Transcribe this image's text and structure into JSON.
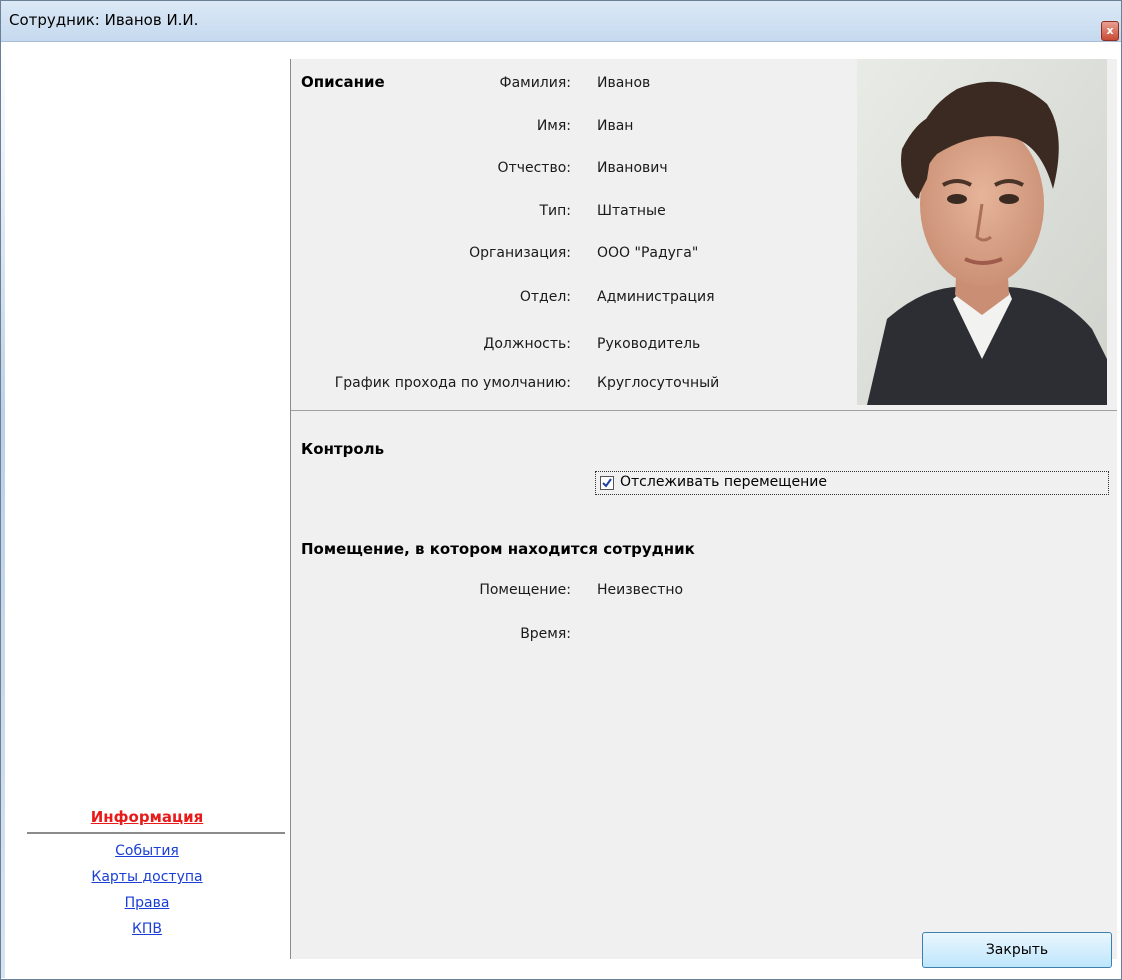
{
  "window": {
    "title": "Сотрудник: Иванов И.И.",
    "close_glyph": "x"
  },
  "sidebar": {
    "items": [
      {
        "label": "Информация",
        "active": true
      },
      {
        "label": "События",
        "active": false
      },
      {
        "label": "Карты доступа",
        "active": false
      },
      {
        "label": "Права",
        "active": false
      },
      {
        "label": "КПВ",
        "active": false
      }
    ]
  },
  "description": {
    "heading": "Описание",
    "fields": [
      {
        "label": "Фамилия:",
        "value": "Иванов"
      },
      {
        "label": "Имя:",
        "value": "Иван"
      },
      {
        "label": "Отчество:",
        "value": "Иванович"
      },
      {
        "label": "Тип:",
        "value": "Штатные"
      },
      {
        "label": "Организация:",
        "value": "ООО \"Радуга\""
      },
      {
        "label": "Отдел:",
        "value": "Администрация"
      },
      {
        "label": "Должность:",
        "value": "Руководитель"
      },
      {
        "label": "График прохода по умолчанию:",
        "value": "Круглосуточный"
      }
    ]
  },
  "control": {
    "heading": "Контроль",
    "track_movement_label": "Отслеживать перемещение",
    "track_movement_checked": true
  },
  "location": {
    "heading": "Помещение, в котором находится сотрудник",
    "room_label": "Помещение:",
    "room_value": "Неизвестно",
    "time_label": "Время:",
    "time_value": ""
  },
  "footer": {
    "close_label": "Закрыть"
  },
  "colors": {
    "active_nav": "#e81a1a",
    "link": "#1a3fd6",
    "panel_bg": "#f0f0f0"
  }
}
